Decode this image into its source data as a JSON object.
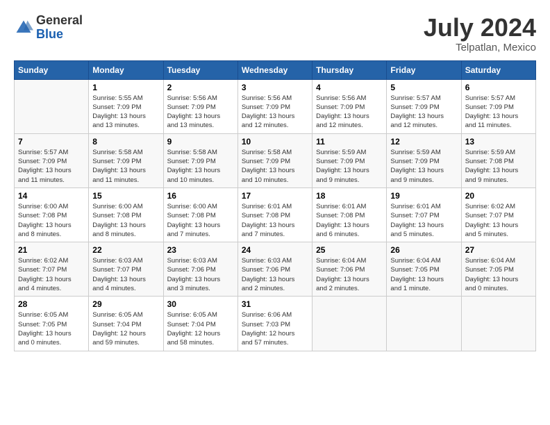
{
  "header": {
    "logo_general": "General",
    "logo_blue": "Blue",
    "month": "July 2024",
    "location": "Telpatlan, Mexico"
  },
  "calendar": {
    "days_of_week": [
      "Sunday",
      "Monday",
      "Tuesday",
      "Wednesday",
      "Thursday",
      "Friday",
      "Saturday"
    ],
    "weeks": [
      [
        {
          "day": "",
          "info": ""
        },
        {
          "day": "1",
          "info": "Sunrise: 5:55 AM\nSunset: 7:09 PM\nDaylight: 13 hours\nand 13 minutes."
        },
        {
          "day": "2",
          "info": "Sunrise: 5:56 AM\nSunset: 7:09 PM\nDaylight: 13 hours\nand 13 minutes."
        },
        {
          "day": "3",
          "info": "Sunrise: 5:56 AM\nSunset: 7:09 PM\nDaylight: 13 hours\nand 12 minutes."
        },
        {
          "day": "4",
          "info": "Sunrise: 5:56 AM\nSunset: 7:09 PM\nDaylight: 13 hours\nand 12 minutes."
        },
        {
          "day": "5",
          "info": "Sunrise: 5:57 AM\nSunset: 7:09 PM\nDaylight: 13 hours\nand 12 minutes."
        },
        {
          "day": "6",
          "info": "Sunrise: 5:57 AM\nSunset: 7:09 PM\nDaylight: 13 hours\nand 11 minutes."
        }
      ],
      [
        {
          "day": "7",
          "info": "Sunrise: 5:57 AM\nSunset: 7:09 PM\nDaylight: 13 hours\nand 11 minutes."
        },
        {
          "day": "8",
          "info": "Sunrise: 5:58 AM\nSunset: 7:09 PM\nDaylight: 13 hours\nand 11 minutes."
        },
        {
          "day": "9",
          "info": "Sunrise: 5:58 AM\nSunset: 7:09 PM\nDaylight: 13 hours\nand 10 minutes."
        },
        {
          "day": "10",
          "info": "Sunrise: 5:58 AM\nSunset: 7:09 PM\nDaylight: 13 hours\nand 10 minutes."
        },
        {
          "day": "11",
          "info": "Sunrise: 5:59 AM\nSunset: 7:09 PM\nDaylight: 13 hours\nand 9 minutes."
        },
        {
          "day": "12",
          "info": "Sunrise: 5:59 AM\nSunset: 7:09 PM\nDaylight: 13 hours\nand 9 minutes."
        },
        {
          "day": "13",
          "info": "Sunrise: 5:59 AM\nSunset: 7:08 PM\nDaylight: 13 hours\nand 9 minutes."
        }
      ],
      [
        {
          "day": "14",
          "info": "Sunrise: 6:00 AM\nSunset: 7:08 PM\nDaylight: 13 hours\nand 8 minutes."
        },
        {
          "day": "15",
          "info": "Sunrise: 6:00 AM\nSunset: 7:08 PM\nDaylight: 13 hours\nand 8 minutes."
        },
        {
          "day": "16",
          "info": "Sunrise: 6:00 AM\nSunset: 7:08 PM\nDaylight: 13 hours\nand 7 minutes."
        },
        {
          "day": "17",
          "info": "Sunrise: 6:01 AM\nSunset: 7:08 PM\nDaylight: 13 hours\nand 7 minutes."
        },
        {
          "day": "18",
          "info": "Sunrise: 6:01 AM\nSunset: 7:08 PM\nDaylight: 13 hours\nand 6 minutes."
        },
        {
          "day": "19",
          "info": "Sunrise: 6:01 AM\nSunset: 7:07 PM\nDaylight: 13 hours\nand 5 minutes."
        },
        {
          "day": "20",
          "info": "Sunrise: 6:02 AM\nSunset: 7:07 PM\nDaylight: 13 hours\nand 5 minutes."
        }
      ],
      [
        {
          "day": "21",
          "info": "Sunrise: 6:02 AM\nSunset: 7:07 PM\nDaylight: 13 hours\nand 4 minutes."
        },
        {
          "day": "22",
          "info": "Sunrise: 6:03 AM\nSunset: 7:07 PM\nDaylight: 13 hours\nand 4 minutes."
        },
        {
          "day": "23",
          "info": "Sunrise: 6:03 AM\nSunset: 7:06 PM\nDaylight: 13 hours\nand 3 minutes."
        },
        {
          "day": "24",
          "info": "Sunrise: 6:03 AM\nSunset: 7:06 PM\nDaylight: 13 hours\nand 2 minutes."
        },
        {
          "day": "25",
          "info": "Sunrise: 6:04 AM\nSunset: 7:06 PM\nDaylight: 13 hours\nand 2 minutes."
        },
        {
          "day": "26",
          "info": "Sunrise: 6:04 AM\nSunset: 7:05 PM\nDaylight: 13 hours\nand 1 minute."
        },
        {
          "day": "27",
          "info": "Sunrise: 6:04 AM\nSunset: 7:05 PM\nDaylight: 13 hours\nand 0 minutes."
        }
      ],
      [
        {
          "day": "28",
          "info": "Sunrise: 6:05 AM\nSunset: 7:05 PM\nDaylight: 13 hours\nand 0 minutes."
        },
        {
          "day": "29",
          "info": "Sunrise: 6:05 AM\nSunset: 7:04 PM\nDaylight: 12 hours\nand 59 minutes."
        },
        {
          "day": "30",
          "info": "Sunrise: 6:05 AM\nSunset: 7:04 PM\nDaylight: 12 hours\nand 58 minutes."
        },
        {
          "day": "31",
          "info": "Sunrise: 6:06 AM\nSunset: 7:03 PM\nDaylight: 12 hours\nand 57 minutes."
        },
        {
          "day": "",
          "info": ""
        },
        {
          "day": "",
          "info": ""
        },
        {
          "day": "",
          "info": ""
        }
      ]
    ]
  }
}
